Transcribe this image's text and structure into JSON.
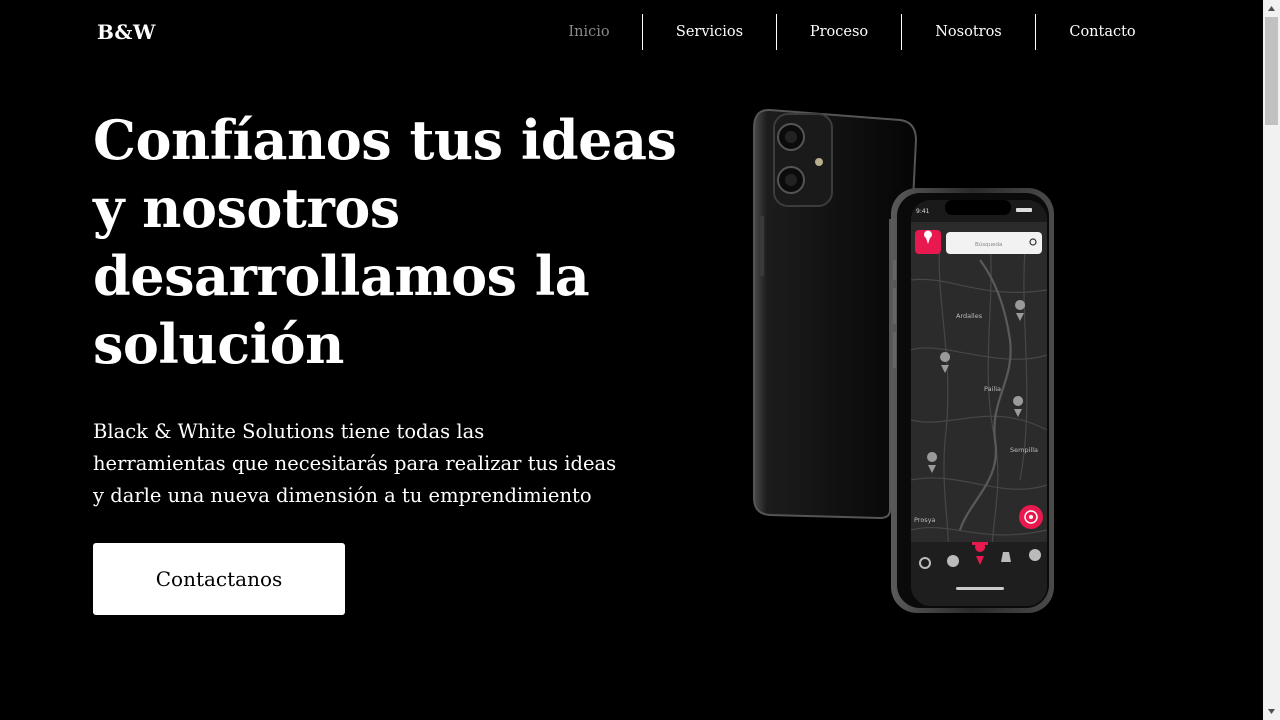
{
  "header": {
    "logo": "B&W",
    "nav": [
      {
        "label": "Inicio",
        "active": true
      },
      {
        "label": "Servicios",
        "active": false
      },
      {
        "label": "Proceso",
        "active": false
      },
      {
        "label": "Nosotros",
        "active": false
      },
      {
        "label": "Contacto",
        "active": false
      }
    ]
  },
  "hero": {
    "title_lines": [
      "Confíanos tus ideas",
      "y nosotros",
      "desarrollamos la",
      "solución"
    ],
    "description_lines": [
      "Black & White Solutions tiene todas las",
      "herramientas que necesitarás para realizar tus ideas",
      "y darle una nueva dimensión a tu emprendimiento"
    ],
    "cta_label": "Contactanos"
  },
  "phone_screen": {
    "status_time": "9:41",
    "search_placeholder": "Búsqueda",
    "map_labels": [
      "Ardalles",
      "Pailia",
      "Sempilla",
      "Prosya"
    ],
    "accent_color": "#e8194f"
  },
  "colors": {
    "background": "#000000",
    "text": "#ffffff",
    "nav_active": "#8a8a8a",
    "cta_background": "#ffffff",
    "cta_text": "#000000"
  }
}
